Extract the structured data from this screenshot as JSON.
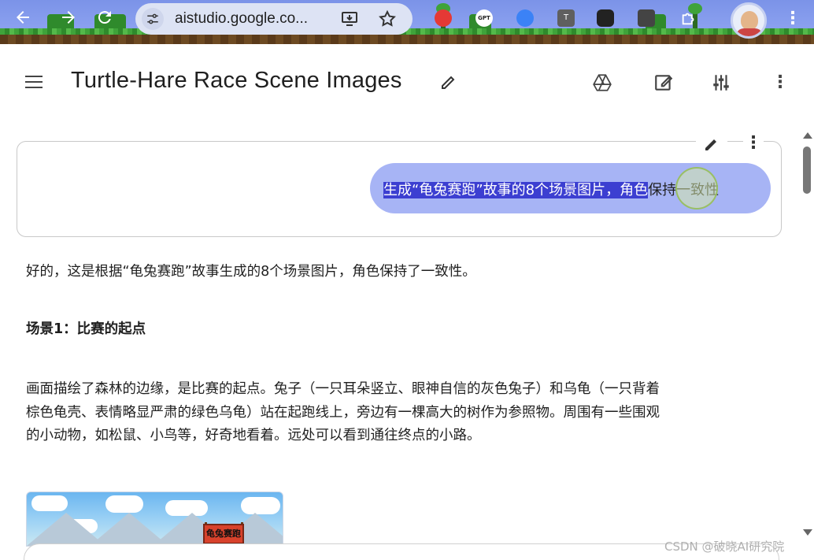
{
  "browser": {
    "url": "aistudio.google.co...",
    "back_icon": "back-arrow-icon",
    "forward_icon": "forward-arrow-icon",
    "reload_icon": "reload-icon",
    "extension_labels": [
      "GPT",
      "T"
    ]
  },
  "header": {
    "title": "Turtle-Hare Race Scene Images"
  },
  "prompt": {
    "selected_text": "生成“龟兔赛跑”故事的8个场景图片，角色",
    "rest_text": "保持一致性"
  },
  "response": {
    "intro": "好的，这是根据“龟兔赛跑”故事生成的8个场景图片，角色保持了一致性。",
    "scene1_heading": "场景1：比赛的起点",
    "scene1_line1": "画面描绘了森林的边缘，是比赛的起点。兔子（一只耳朵竖立、眼神自信的灰色兔子）和乌龟（一只背着",
    "scene1_line2": "棕色龟壳、表情略显严肃的绿色乌龟）站在起跑线上，旁边有一棵高大的树作为参照物。周围有一些围观",
    "scene1_line3": "的小动物，如松鼠、小鸟等，好奇地看着。远处可以看到通往终点的小路。",
    "image_banner": "龟兔赛跑"
  },
  "watermark": "CSDN @破晓AI研究院",
  "colors": {
    "prompt_bubble": "#a7b4f5",
    "selection": "#3c3fd1",
    "browser_bar": "#7b93e8"
  }
}
